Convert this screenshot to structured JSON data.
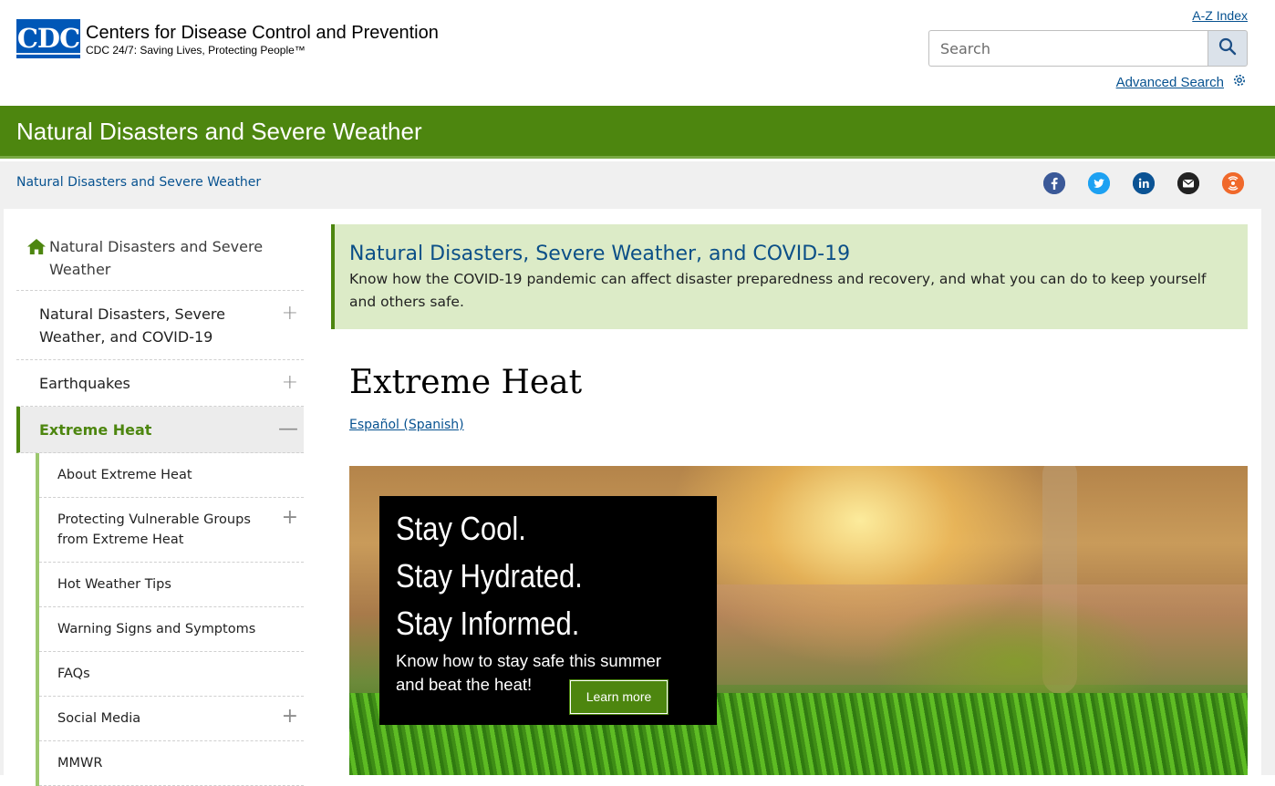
{
  "header": {
    "logo_mark": "CDC",
    "logo_title": "Centers for Disease Control and Prevention",
    "logo_tagline": "CDC 24/7: Saving Lives, Protecting People™",
    "az_index": "A-Z Index",
    "search_placeholder": "Search",
    "advanced_search": "Advanced Search"
  },
  "banner": {
    "title": "Natural Disasters and Severe Weather"
  },
  "breadcrumb": {
    "label": "Natural Disasters and Severe Weather"
  },
  "social": {
    "icons": [
      "facebook-icon",
      "twitter-icon",
      "linkedin-icon",
      "email-icon",
      "syndicate-icon"
    ],
    "colors": {
      "facebook": "#3b5998",
      "twitter": "#1da1f2",
      "linkedin": "#0b5394",
      "email": "#222222",
      "syndicate": "#f0692b"
    }
  },
  "sidenav": {
    "home": "Natural Disasters and Severe Weather",
    "items": [
      {
        "label": "Natural Disasters, Severe Weather, and COVID-19",
        "toggle": "+"
      },
      {
        "label": "Earthquakes",
        "toggle": "+"
      },
      {
        "label": "Extreme Heat",
        "toggle": "—"
      }
    ],
    "sub_items": [
      {
        "label": "About Extreme Heat",
        "toggle": ""
      },
      {
        "label": "Protecting Vulnerable Groups from Extreme Heat",
        "toggle": "+"
      },
      {
        "label": "Hot Weather Tips",
        "toggle": ""
      },
      {
        "label": "Warning Signs and Symptoms",
        "toggle": ""
      },
      {
        "label": "FAQs",
        "toggle": ""
      },
      {
        "label": "Social Media",
        "toggle": "+"
      },
      {
        "label": "MMWR",
        "toggle": ""
      }
    ]
  },
  "callout": {
    "title": "Natural Disasters, Severe Weather, and COVID-19",
    "text": "Know how the COVID-19 pandemic can affect disaster preparedness and recovery, and what you can do to keep yourself and others safe."
  },
  "main": {
    "title": "Extreme Heat",
    "spanish_link": "Español (Spanish)"
  },
  "hero": {
    "lines": [
      "Stay Cool.",
      "Stay Hydrated.",
      "Stay Informed."
    ],
    "subtext": "Know how to stay safe this summer and beat the heat!",
    "button": "Learn more"
  },
  "colors": {
    "brand_green": "#4d860f",
    "link_blue": "#075290",
    "callout_bg": "#dcebc7"
  }
}
